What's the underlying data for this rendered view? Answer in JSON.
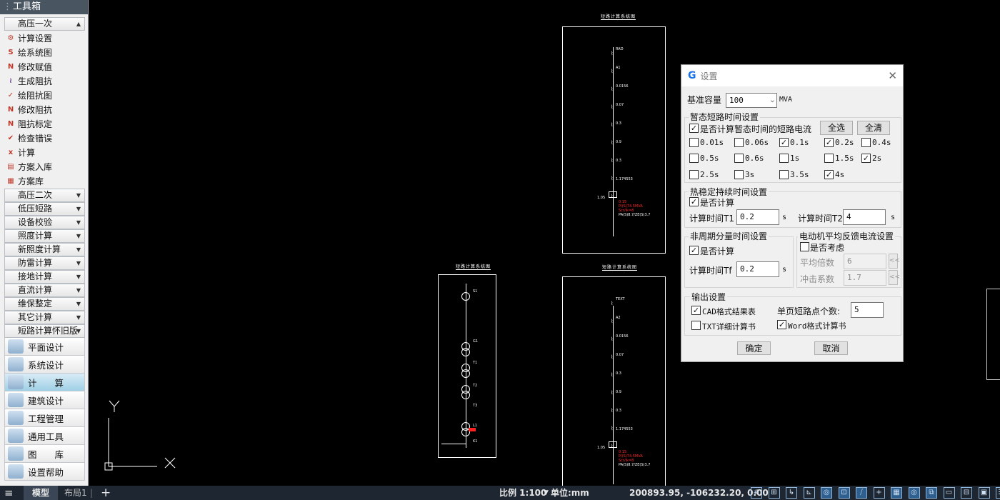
{
  "toolbox": {
    "title": "工具箱",
    "open_group": "高压一次",
    "tools": [
      {
        "label": "计算设置",
        "icon": "calc-settings-icon",
        "glyph": "⚙",
        "color": "#c0392b"
      },
      {
        "label": "绘系统图",
        "icon": "draw-system-icon",
        "glyph": "S",
        "color": "#c0392b"
      },
      {
        "label": "修改赋值",
        "icon": "edit-value-icon",
        "glyph": "N",
        "color": "#c0392b"
      },
      {
        "label": "生成阻抗",
        "icon": "gen-impedance-icon",
        "glyph": "≀",
        "color": "#5b2d82"
      },
      {
        "label": "绘阻抗图",
        "icon": "draw-impedance-icon",
        "glyph": "✓",
        "color": "#c0392b"
      },
      {
        "label": "修改阻抗",
        "icon": "edit-impedance-icon",
        "glyph": "N",
        "color": "#c0392b"
      },
      {
        "label": "阻抗标定",
        "icon": "impedance-mark-icon",
        "glyph": "N",
        "color": "#c0392b"
      },
      {
        "label": "检查错误",
        "icon": "check-error-icon",
        "glyph": "✔",
        "color": "#c0392b"
      },
      {
        "label": "计算",
        "icon": "calculate-icon",
        "glyph": "x",
        "color": "#c0392b"
      },
      {
        "label": "方案入库",
        "icon": "scheme-store-icon",
        "glyph": "▤",
        "color": "#c0392b"
      },
      {
        "label": "方案库",
        "icon": "scheme-lib-icon",
        "glyph": "▦",
        "color": "#c0392b"
      }
    ],
    "groups": [
      "高压二次",
      "低压短路",
      "设备校验",
      "照度计算",
      "新照度计算",
      "防雷计算",
      "接地计算",
      "直流计算",
      "维保整定",
      "其它计算",
      "短路计算怀旧版"
    ],
    "big_buttons": [
      {
        "label": "平面设计",
        "icon": "plane-design-icon"
      },
      {
        "label": "系统设计",
        "icon": "system-design-icon"
      },
      {
        "label": "计　　算",
        "icon": "calculation-icon"
      },
      {
        "label": "建筑设计",
        "icon": "architecture-design-icon"
      },
      {
        "label": "工程管理",
        "icon": "project-manage-icon"
      },
      {
        "label": "通用工具",
        "icon": "common-tools-icon"
      },
      {
        "label": "图　　库",
        "icon": "library-icon"
      },
      {
        "label": "设置帮助",
        "icon": "settings-help-icon"
      }
    ],
    "active_big_button": 2
  },
  "drawing": {
    "frame_titles": [
      "短路计算系统图",
      "短路计算系统图",
      "短路计算系统图"
    ],
    "labels_a": [
      "RAD",
      "A1",
      "0.0156",
      "0.07",
      "0.3",
      "0.9",
      "0.3",
      "1.174553",
      "1.05",
      "0.15",
      "P/(S)74.5MVA",
      "Scr/ik=8",
      "PA(S)8.7/ZE(S)3.7"
    ],
    "labels_b": [
      "TEXT",
      "A2",
      "0.0156",
      "0.07",
      "0.3",
      "0.9",
      "0.3",
      "1.174553",
      "1.05",
      "0.15",
      "P/(S)74.5MVA",
      "Scr/ik=8",
      "PA(S)8.7/ZE(S)3.7"
    ],
    "labels_c": [
      "S1",
      "G1",
      "T1",
      "T2",
      "T3",
      "L1",
      "K1"
    ],
    "axis_y": "Y",
    "axis_x": "X"
  },
  "dialog": {
    "title": "设置",
    "base_capacity_label": "基准容量",
    "base_capacity_value": "100",
    "base_capacity_unit": "MVA",
    "transient": {
      "title": "暂态短路时间设置",
      "enable_label": "是否计算暂态时间的短路电流",
      "enable_checked": true,
      "select_all": "全选",
      "clear_all": "全清",
      "times": [
        {
          "label": "0.01s",
          "checked": false
        },
        {
          "label": "0.06s",
          "checked": false
        },
        {
          "label": "0.1s",
          "checked": true
        },
        {
          "label": "0.2s",
          "checked": true
        },
        {
          "label": "0.4s",
          "checked": false
        },
        {
          "label": "0.5s",
          "checked": false
        },
        {
          "label": "0.6s",
          "checked": false
        },
        {
          "label": "1s",
          "checked": false
        },
        {
          "label": "1.5s",
          "checked": false
        },
        {
          "label": "2s",
          "checked": true
        },
        {
          "label": "2.5s",
          "checked": false
        },
        {
          "label": "3s",
          "checked": false
        },
        {
          "label": "3.5s",
          "checked": false
        },
        {
          "label": "4s",
          "checked": true
        }
      ]
    },
    "thermal": {
      "title": "热稳定持续时间设置",
      "enable_label": "是否计算",
      "enable_checked": true,
      "t1_label": "计算时间T1",
      "t1_value": "0.2",
      "t2_label": "计算时间T2",
      "t2_value": "4",
      "unit": "s"
    },
    "aperiodic": {
      "title": "非周期分量时间设置",
      "enable_label": "是否计算",
      "enable_checked": true,
      "tf_label": "计算时间Tf",
      "tf_value": "0.2",
      "unit": "s"
    },
    "motor": {
      "title": "电动机平均反馈电流设置",
      "enable_label": "是否考虑",
      "enable_checked": false,
      "avg_label": "平均倍数",
      "avg_value": "6",
      "impact_label": "冲击系数",
      "impact_value": "1.7",
      "pick": "<<"
    },
    "output": {
      "title": "输出设置",
      "cad_label": "CAD格式结果表",
      "cad_checked": true,
      "txt_label": "TXT详细计算书",
      "txt_checked": false,
      "word_label": "Word格式计算书",
      "word_checked": true,
      "points_label": "单页短路点个数:",
      "points_value": "5"
    },
    "ok": "确定",
    "cancel": "取消"
  },
  "status": {
    "menu_icon": "≡",
    "tab_model": "模型",
    "tab_layout": "布局1",
    "add_tab": "+",
    "scale": "比例 1:100",
    "unit": "单位:mm",
    "coords": "200893.95, -106232.20, 0.00",
    "icons": [
      "grid-icon",
      "snap-icon",
      "ortho-icon",
      "polar-icon",
      "osnap-icon",
      "otrack-icon",
      "lineweight-icon",
      "dyn-icon",
      "qp-icon",
      "sel-cycle-icon",
      "anno-icon",
      "workspace-icon",
      "lock-icon",
      "fullscreen-icon",
      "custom-icon"
    ],
    "icon_glyphs": [
      "#",
      "⊞",
      "↳",
      "⊾",
      "◎",
      "⊡",
      "⧸",
      "+",
      "▦",
      "◎",
      "⧉",
      "▭",
      "⊟",
      "▣",
      "☰"
    ],
    "icon_on": [
      false,
      false,
      false,
      false,
      true,
      true,
      true,
      false,
      true,
      true,
      true,
      false,
      false,
      false,
      false
    ]
  }
}
